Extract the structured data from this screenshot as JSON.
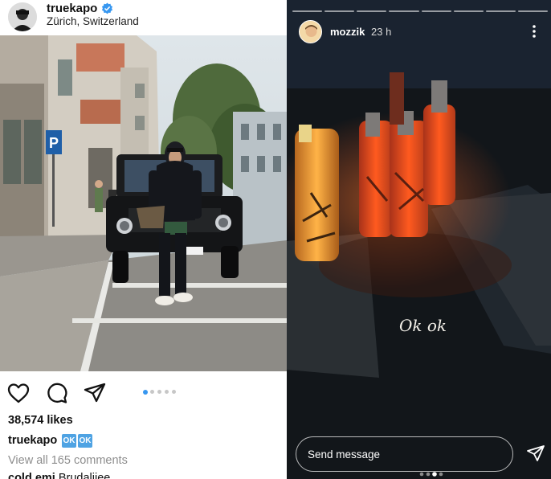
{
  "post": {
    "username": "truekapo",
    "location": "Zürich, Switzerland",
    "likes": "38,574 likes",
    "caption_user": "truekapo",
    "caption_emoji": [
      "OK",
      "OK"
    ],
    "view_comments": "View all 165 comments",
    "comment_user": "cold.emi",
    "comment_text": "Brudaliiee",
    "parking_sign": "P",
    "carousel": {
      "total": 5,
      "active": 1
    }
  },
  "story": {
    "username": "mozzik",
    "time": "23 h",
    "text": "Ok ok",
    "send_placeholder": "Send message",
    "segments": 8
  },
  "colors": {
    "verified": "#3797f0",
    "ok_emoji": "#4fa3e3",
    "story_bg": "#12161a",
    "bottle_glow": "#ff5a1f"
  },
  "icons": [
    "verified-badge-icon",
    "heart-icon",
    "comment-icon",
    "share-icon",
    "more-options-icon",
    "send-icon"
  ]
}
